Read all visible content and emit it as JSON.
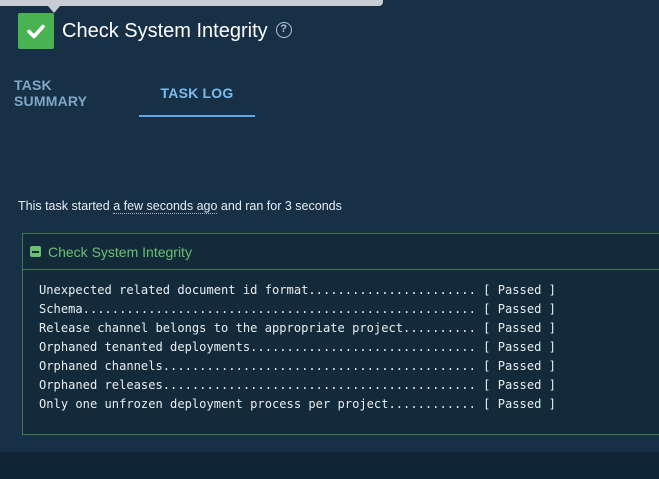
{
  "header": {
    "title": "Check System Integrity",
    "status_icon": "check-icon",
    "status_color": "#48b350",
    "help_icon": "help-icon",
    "help_glyph": "?"
  },
  "tabs": [
    {
      "label": "TASK SUMMARY",
      "active": false
    },
    {
      "label": "TASK LOG",
      "active": true
    }
  ],
  "task_info": {
    "prefix": "This task started",
    "started": "a few seconds ago",
    "middle": "and ran for",
    "duration": "3 seconds"
  },
  "log": {
    "title": "Check System Integrity",
    "accent_color": "#6ac06f",
    "lines": [
      "Unexpected related document id format....................... [ Passed ]",
      "Schema...................................................... [ Passed ]",
      "Release channel belongs to the appropriate project.......... [ Passed ]",
      "Orphaned tenanted deployments............................... [ Passed ]",
      "Orphaned channels........................................... [ Passed ]",
      "Orphaned releases........................................... [ Passed ]",
      "Only one unfrozen deployment process per project............ [ Passed ]"
    ]
  }
}
